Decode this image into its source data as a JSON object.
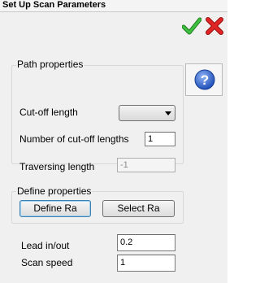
{
  "window": {
    "title": "Set Up Scan Parameters"
  },
  "toolbar": {
    "ok_icon": "check-icon",
    "cancel_icon": "close-icon",
    "help_icon": "help-icon"
  },
  "path_properties": {
    "title": "Path properties",
    "cutoff_length_label": "Cut-off length",
    "cutoff_length_value": "",
    "num_cutoff_label": "Number of cut-off lengths",
    "num_cutoff_value": "1",
    "traversing_label": "Traversing length",
    "traversing_value": "-1"
  },
  "define_properties": {
    "title": "Define properties",
    "define_ra_label": "Define Ra",
    "select_ra_label": "Select Ra"
  },
  "scan": {
    "lead_label": "Lead in/out",
    "lead_value": "0.2",
    "speed_label": "Scan speed",
    "speed_value": "1"
  },
  "colors": {
    "ok_green": "#2f9e2f",
    "cancel_red": "#d81e1e",
    "help_blue": "#2f5fc7"
  }
}
